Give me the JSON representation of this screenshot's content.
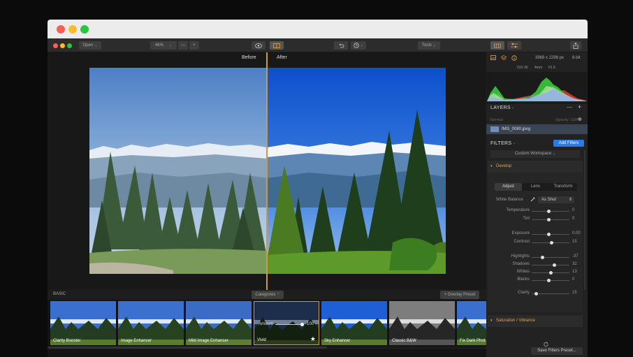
{
  "toolbar": {
    "open_label": "Open",
    "zoom_label": "46%",
    "zoom_out": "—",
    "zoom_in": "+",
    "tools_label": "Tools"
  },
  "canvas": {
    "before_label": "Before",
    "after_label": "After"
  },
  "presets": {
    "basic_label": "BASIC",
    "categories_label": "Categories",
    "overlay_label": "+ Overlay Preset",
    "items": [
      {
        "name": "Clarity Booster"
      },
      {
        "name": "Image Enhancer"
      },
      {
        "name": "Mild Image Enhancer"
      },
      {
        "name": "Vivid"
      },
      {
        "name": "Sky Enhancer"
      },
      {
        "name": "Classic B&W"
      },
      {
        "name": "Fix Dark Phot"
      }
    ],
    "amount_label": "Amount",
    "amount_value": "100"
  },
  "info": {
    "dimensions": "3968 x 2298 px",
    "bit": "8-bit",
    "iso": "ISO 30",
    "focal": "4mm",
    "aperture": "f/1.8"
  },
  "layers": {
    "title": "LAYERS",
    "blend": "Normal",
    "opacity": "Opacity: 100%",
    "file": "IMG_0080.jpeg"
  },
  "filters": {
    "title": "FILTERS",
    "add_label": "Add Filters",
    "workspace": "Custom Workspace",
    "develop": "Develop",
    "tabs": [
      "Adjust",
      "Lens",
      "Transform"
    ],
    "wb_label": "White Balance",
    "wb_value": "As Shot",
    "sliders": [
      {
        "label": "Temperature",
        "value": "0",
        "pos": 0.45
      },
      {
        "label": "Tint",
        "value": "0",
        "pos": 0.45
      },
      {
        "label": "Exposure",
        "value": "0.00",
        "pos": 0.45
      },
      {
        "label": "Contrast",
        "value": "15",
        "pos": 0.52
      },
      {
        "label": "Highlights",
        "value": "-37",
        "pos": 0.28
      },
      {
        "label": "Shadows",
        "value": "32",
        "pos": 0.6
      },
      {
        "label": "Whites",
        "value": "13",
        "pos": 0.5
      },
      {
        "label": "Blacks",
        "value": "0",
        "pos": 0.45
      },
      {
        "label": "Clarity",
        "value": "15",
        "pos": 0.12
      }
    ],
    "saturation": "Saturation / Vibrance",
    "save_label": "Save Filters Preset..."
  }
}
